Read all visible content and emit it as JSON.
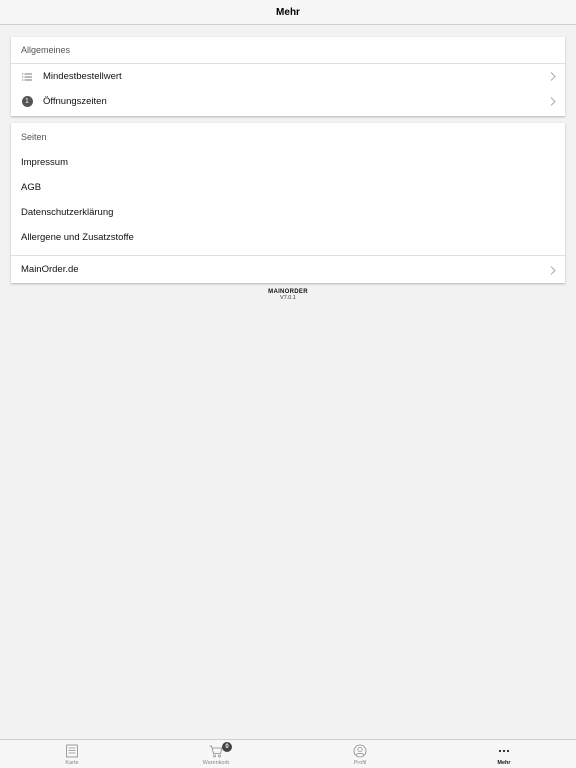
{
  "navbar": {
    "title": "Mehr"
  },
  "general": {
    "header": "Allgemeines",
    "items": [
      {
        "label": "Mindestbestellwert",
        "icon": "list-icon"
      },
      {
        "label": "Öffnungszeiten",
        "icon": "number-badge",
        "badge": "1"
      }
    ]
  },
  "pages": {
    "header": "Seiten",
    "items": [
      {
        "label": "Impressum"
      },
      {
        "label": "AGB"
      },
      {
        "label": "Datenschutzerklärung"
      },
      {
        "label": "Allergene und Zusatzstoffe"
      }
    ],
    "site_link": "MainOrder.de"
  },
  "brand": {
    "logo": "MAINORDER",
    "version": "V7.0.1"
  },
  "tabbar": {
    "tabs": [
      {
        "label": "Karte",
        "icon": "menu-card-icon"
      },
      {
        "label": "Warenkorb",
        "icon": "cart-icon",
        "badge": "0"
      },
      {
        "label": "Profil",
        "icon": "profile-icon"
      },
      {
        "label": "Mehr",
        "icon": "more-icon",
        "active": true
      }
    ]
  },
  "colors": {
    "accent": "#111111",
    "badge": "#444444",
    "inactive_tab": "#888888"
  }
}
